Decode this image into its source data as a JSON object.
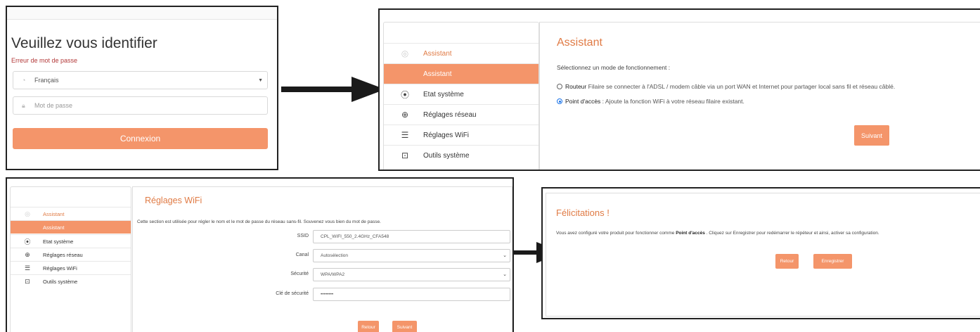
{
  "login": {
    "title": "Veuillez vous identifier",
    "error": "Erreur de mot de passe",
    "language": "Français",
    "password_placeholder": "Mot de passe",
    "submit_label": "Connexion"
  },
  "sidebar": {
    "items": [
      {
        "label": "Assistant",
        "icon": "wizard-icon"
      },
      {
        "label": "Assistant"
      },
      {
        "label": "Etat système",
        "icon": "broadcast-icon"
      },
      {
        "label": "Réglages réseau",
        "icon": "globe-icon"
      },
      {
        "label": "Réglages WiFi",
        "icon": "wifi-icon"
      },
      {
        "label": "Outils système",
        "icon": "toolbox-icon"
      }
    ]
  },
  "assistant": {
    "title": "Assistant",
    "subtitle": "Sélectionnez un mode de fonctionnement :",
    "option_router_name": "Routeur",
    "option_router_desc": "Filaire se connecter à l'ADSL / modem câble via un port WAN et Internet pour partager local sans fil et réseau câblé.",
    "option_ap_name": "Point d'accès",
    "option_ap_desc": " : Ajoute la fonction WiFi à votre réseau filaire existant.",
    "selected": "Point d'accès",
    "next_label": "Suivant"
  },
  "wifi": {
    "title": "Réglages WiFi",
    "description": "Cette section est utilisée pour régler le nom et le mot de passe du réseau sans-fil. Souvenez vous bien du mot de passe.",
    "fields": [
      {
        "label": "SSID",
        "value": "CPL_WIFI_550_2.4GHz_CFA548"
      },
      {
        "label": "Canal",
        "value": "Autosélection"
      },
      {
        "label": "Sécurité",
        "value": "WPA/WPA2"
      },
      {
        "label": "Clé de sécurité",
        "value": "••••••••"
      }
    ],
    "back_label": "Retour",
    "next_label": "Suivant"
  },
  "congrats": {
    "title": "Félicitations !",
    "text_before": "Vous avez configuré votre produit pour fonctionner comme ",
    "mode": "Point d'accès",
    "text_after": " . Cliquez sur Enregistrer pour redémarrer le répéteur et ainsi, activer sa configuration.",
    "back_label": "Retour",
    "save_label": "Enregistrer"
  },
  "colors": {
    "accent": "#f4956a",
    "title": "#e07b45",
    "error": "#b33a3a"
  }
}
